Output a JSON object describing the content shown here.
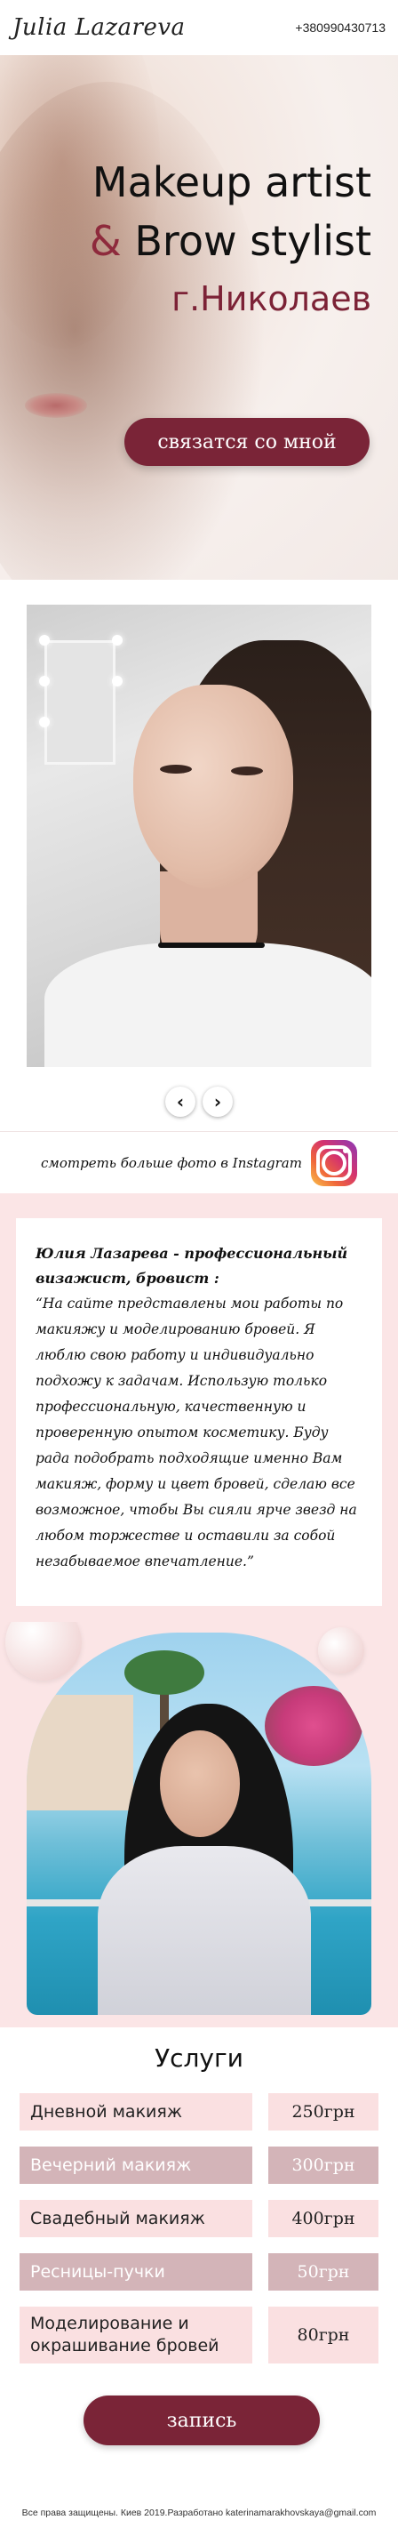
{
  "header": {
    "logo": "Julia Lazareva",
    "phone": "+380990430713"
  },
  "hero": {
    "title_line1": "Makeup artist",
    "title_amp": "&",
    "title_line2": " Brow stylist",
    "city": "г.Николаев",
    "cta_label": "связатся со мной"
  },
  "gallery": {
    "prev_icon": "‹",
    "next_icon": "›"
  },
  "instagram": {
    "text": "смотреть больше фото в Instagram",
    "icon": "instagram-icon"
  },
  "about": {
    "lead": "Юлия Лазарева - профессиональный визажист, бровист :",
    "quote": "“На сайте представлены мои работы по макияжу и моделированию бровей. Я люблю свою работу и индивидуально подхожу к задачам. Использую только профессиональную, качественную и проверенную опытом косметику. Буду рада подобрать подходящие именно Вам макияж, форму и цвет бровей, сделаю все возможное, чтобы Вы сияли ярче звезд на любом торжестве и оставили за собой незабываемое впечатление.”"
  },
  "services": {
    "title": "Услуги",
    "items": [
      {
        "name": "Дневной макияж",
        "price": "250грн"
      },
      {
        "name": "Вечерний макияж",
        "price": "300грн"
      },
      {
        "name": "Свадебный макияж",
        "price": "400грн"
      },
      {
        "name": "Ресницы-пучки",
        "price": "50грн"
      },
      {
        "name": "Моделирование и окрашивание бровей",
        "price": "80грн"
      }
    ],
    "book_label": "запись"
  },
  "footer": {
    "text": "Все права защищены. Киев 2019.Разработано katerinamarakhovskaya@gmail.com"
  },
  "colors": {
    "accent": "#7a2437",
    "pink_bg": "#fbe5e6",
    "row_light": "#fae0e1",
    "row_dark": "#d3b4b8"
  }
}
